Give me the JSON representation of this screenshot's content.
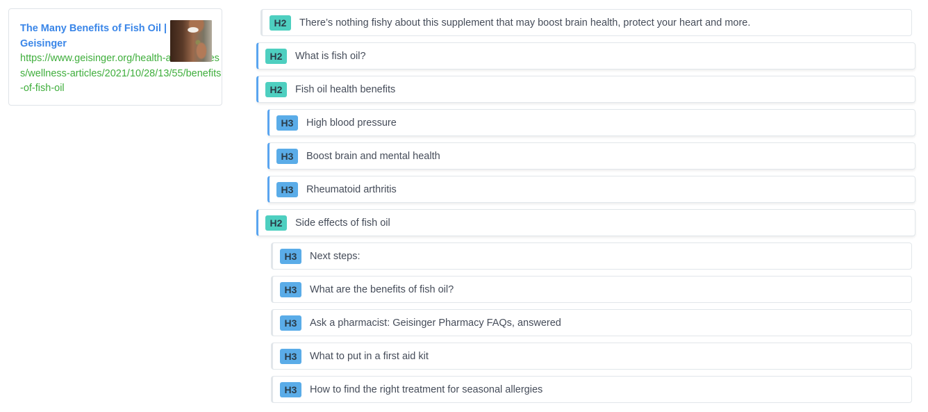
{
  "result": {
    "title": "The Many Benefits of Fish Oil | Geisinger",
    "url": "https://www.geisinger.org/health-and-wellness/wellness-articles/2021/10/28/13/55/benefits-of-fish-oil",
    "thumbnail": "woman-holding-fish-oil-capsule-image"
  },
  "colors": {
    "h2_badge": "#4ecfc0",
    "h3_badge": "#5aace8",
    "active_border": "#5aa5f0",
    "muted_border": "#e1e6ea",
    "title_link": "#3a86e8",
    "url_link": "#3fae3c"
  },
  "outline": [
    {
      "level": "H2",
      "text": "There’s nothing fishy about this supplement that may boost brain health, protect your heart and more.",
      "state": "muted"
    },
    {
      "level": "H2",
      "text": "What is fish oil?",
      "state": "active"
    },
    {
      "level": "H2",
      "text": "Fish oil health benefits",
      "state": "active"
    },
    {
      "level": "H3",
      "text": "High blood pressure",
      "state": "active"
    },
    {
      "level": "H3",
      "text": "Boost brain and mental health",
      "state": "active"
    },
    {
      "level": "H3",
      "text": "Rheumatoid arthritis",
      "state": "active"
    },
    {
      "level": "H2",
      "text": "Side effects of fish oil",
      "state": "active"
    },
    {
      "level": "H3",
      "text": "Next steps:",
      "state": "muted"
    },
    {
      "level": "H3",
      "text": "What are the benefits of fish oil?",
      "state": "muted"
    },
    {
      "level": "H3",
      "text": "Ask a pharmacist: Geisinger Pharmacy FAQs, answered",
      "state": "muted"
    },
    {
      "level": "H3",
      "text": "What to put in a first aid kit",
      "state": "muted"
    },
    {
      "level": "H3",
      "text": "How to find the right treatment for seasonal allergies",
      "state": "muted"
    }
  ]
}
